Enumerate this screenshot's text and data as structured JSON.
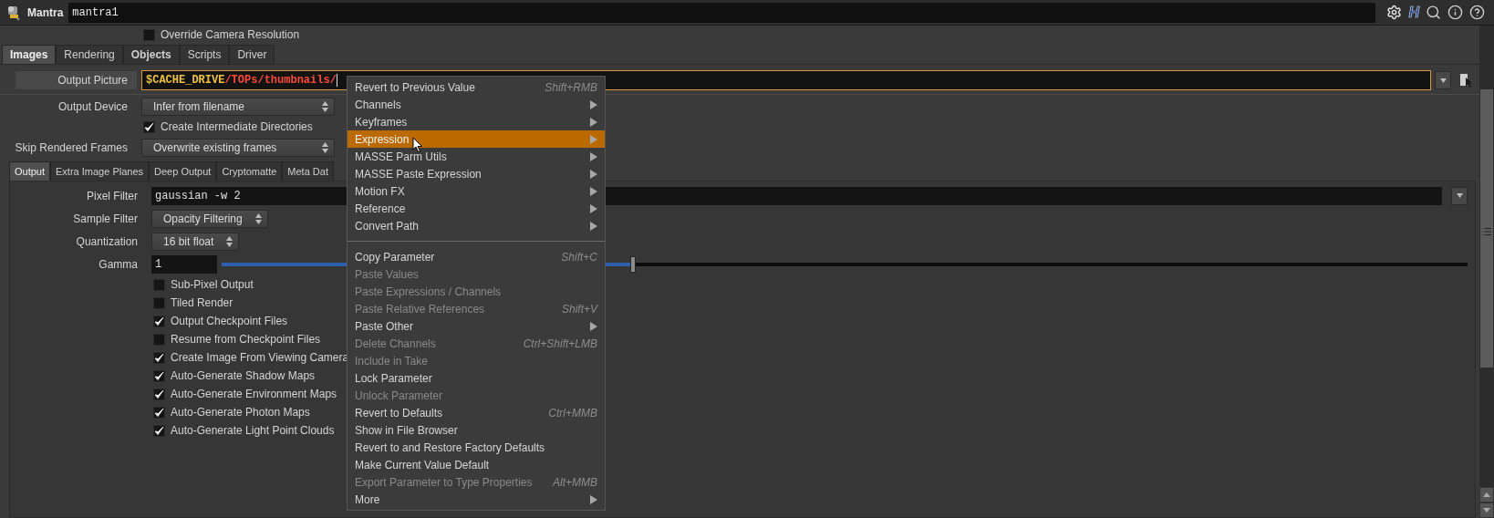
{
  "header": {
    "node_type": "Mantra",
    "node_name": "mantra1",
    "help_logo": "H"
  },
  "override_camera": {
    "label": "Override Camera Resolution",
    "checked": false
  },
  "tabs": [
    {
      "label": "Images",
      "selected": true,
      "bold": true
    },
    {
      "label": "Rendering",
      "selected": false,
      "bold": false
    },
    {
      "label": "Objects",
      "selected": false,
      "bold": true
    },
    {
      "label": "Scripts",
      "selected": false,
      "bold": false
    },
    {
      "label": "Driver",
      "selected": false,
      "bold": false
    }
  ],
  "output_picture": {
    "label": "Output Picture",
    "segments": [
      {
        "text": "$CACHE_DRIVE",
        "kind": "variable"
      },
      {
        "text": "/TOPs/thumbnails/",
        "kind": "path"
      }
    ]
  },
  "parms": [
    {
      "kind": "dropdown",
      "label": "Output Device",
      "value": "Infer from filename"
    },
    {
      "kind": "checkbox",
      "label": "Create Intermediate Directories",
      "checked": true
    },
    {
      "kind": "dropdown",
      "label": "Skip Rendered Frames",
      "value": "Overwrite existing frames"
    }
  ],
  "subtabs": [
    {
      "label": "Output",
      "selected": true
    },
    {
      "label": "Extra Image Planes",
      "selected": false
    },
    {
      "label": "Deep Output",
      "selected": false
    },
    {
      "label": "Cryptomatte",
      "selected": false
    },
    {
      "label": "Meta Dat",
      "selected": false
    }
  ],
  "sub_parms": [
    {
      "kind": "text",
      "label": "Pixel Filter",
      "value": "gaussian -w 2"
    },
    {
      "kind": "dropdown",
      "label": "Sample Filter",
      "value": "Opacity Filtering"
    },
    {
      "kind": "dropdown",
      "label": "Quantization",
      "value": "16 bit float"
    },
    {
      "kind": "slider",
      "label": "Gamma",
      "value": "1",
      "level": 0.33
    },
    {
      "kind": "checkbox",
      "label": "Sub-Pixel Output",
      "checked": false
    },
    {
      "kind": "checkbox",
      "label": "Tiled Render",
      "checked": false
    },
    {
      "kind": "checkbox",
      "label": "Output Checkpoint Files",
      "checked": true
    },
    {
      "kind": "checkbox",
      "label": "Resume from Checkpoint Files",
      "checked": false
    },
    {
      "kind": "checkbox",
      "label": "Create Image From Viewing Camera",
      "checked": true
    },
    {
      "kind": "checkbox",
      "label": "Auto-Generate Shadow Maps",
      "checked": true
    },
    {
      "kind": "checkbox",
      "label": "Auto-Generate Environment Maps",
      "checked": true
    },
    {
      "kind": "checkbox",
      "label": "Auto-Generate Photon Maps",
      "checked": true
    },
    {
      "kind": "checkbox",
      "label": "Auto-Generate Light Point Clouds",
      "checked": true
    }
  ],
  "context_menu": {
    "items": [
      {
        "kind": "item",
        "label": "Revert to Previous Value",
        "shortcut": "Shift+RMB",
        "submenu": false,
        "disabled": false,
        "selected": false
      },
      {
        "kind": "item",
        "label": "Channels",
        "submenu": true,
        "disabled": false,
        "selected": false
      },
      {
        "kind": "item",
        "label": "Keyframes",
        "submenu": true,
        "disabled": false,
        "selected": false
      },
      {
        "kind": "item",
        "label": "Expression",
        "submenu": true,
        "disabled": false,
        "selected": true
      },
      {
        "kind": "item",
        "label": "MASSE Parm Utils",
        "submenu": true,
        "disabled": false,
        "selected": false
      },
      {
        "kind": "item",
        "label": "MASSE Paste Expression",
        "submenu": true,
        "disabled": false,
        "selected": false
      },
      {
        "kind": "item",
        "label": "Motion FX",
        "submenu": true,
        "disabled": false,
        "selected": false
      },
      {
        "kind": "item",
        "label": "Reference",
        "submenu": true,
        "disabled": false,
        "selected": false
      },
      {
        "kind": "item",
        "label": "Convert Path",
        "submenu": true,
        "disabled": false,
        "selected": false
      },
      {
        "kind": "separator"
      },
      {
        "kind": "item",
        "label": "Copy Parameter",
        "shortcut": "Shift+C",
        "submenu": false,
        "disabled": false,
        "selected": false
      },
      {
        "kind": "item",
        "label": "Paste Values",
        "submenu": false,
        "disabled": true,
        "selected": false
      },
      {
        "kind": "item",
        "label": "Paste Expressions / Channels",
        "submenu": false,
        "disabled": true,
        "selected": false
      },
      {
        "kind": "item",
        "label": "Paste Relative References",
        "shortcut": "Shift+V",
        "submenu": false,
        "disabled": true,
        "selected": false
      },
      {
        "kind": "item",
        "label": "Paste Other",
        "submenu": true,
        "disabled": false,
        "selected": false
      },
      {
        "kind": "item",
        "label": "Delete Channels",
        "shortcut": "Ctrl+Shift+LMB",
        "submenu": false,
        "disabled": true,
        "selected": false
      },
      {
        "kind": "item",
        "label": "Include in Take",
        "submenu": false,
        "disabled": true,
        "selected": false
      },
      {
        "kind": "item",
        "label": "Lock Parameter",
        "submenu": false,
        "disabled": false,
        "selected": false
      },
      {
        "kind": "item",
        "label": "Unlock Parameter",
        "submenu": false,
        "disabled": true,
        "selected": false
      },
      {
        "kind": "item",
        "label": "Revert to Defaults",
        "shortcut": "Ctrl+MMB",
        "submenu": false,
        "disabled": false,
        "selected": false
      },
      {
        "kind": "item",
        "label": "Show in File Browser",
        "submenu": false,
        "disabled": false,
        "selected": false
      },
      {
        "kind": "item",
        "label": "Revert to and Restore Factory Defaults",
        "submenu": false,
        "disabled": false,
        "selected": false
      },
      {
        "kind": "item",
        "label": "Make Current Value Default",
        "submenu": false,
        "disabled": false,
        "selected": false
      },
      {
        "kind": "item",
        "label": "Export Parameter to Type Properties",
        "shortcut": "Alt+MMB",
        "submenu": false,
        "disabled": true,
        "selected": false
      },
      {
        "kind": "item",
        "label": "More",
        "submenu": true,
        "disabled": false,
        "selected": false
      }
    ]
  }
}
